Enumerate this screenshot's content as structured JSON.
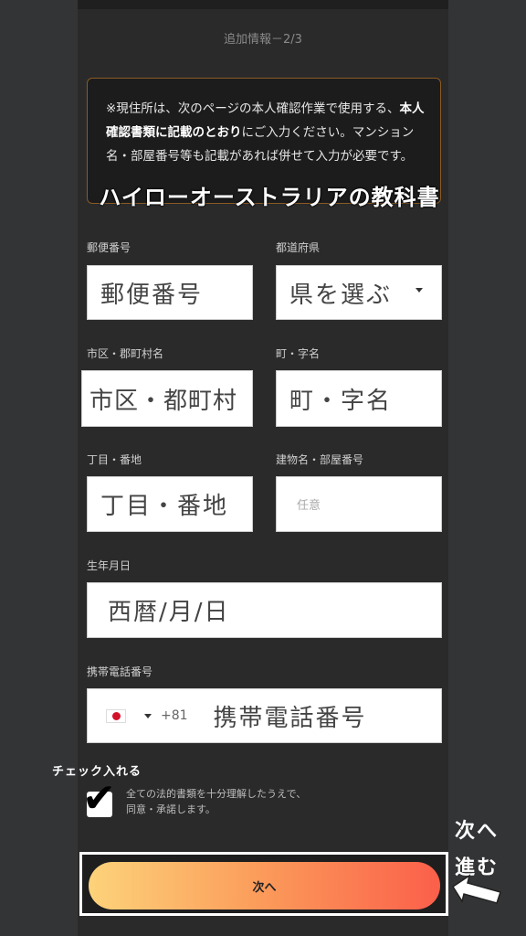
{
  "header": {
    "step": "追加情報－2/3"
  },
  "notice": {
    "part1": "※現住所は、次のページの本人確認作業で使用する、",
    "bold": "本人確認書類に記載のとおり",
    "part2": "にご入力ください。マンション名・部屋番号等も記載があれば併せて入力が必要です。"
  },
  "overlay": {
    "title": "ハイローオーストラリアの教科書"
  },
  "form": {
    "postal": {
      "label": "郵便番号",
      "placeholder": "郵便番号"
    },
    "prefecture": {
      "label": "都道府県",
      "value": "県を選ぶ"
    },
    "city": {
      "label": "市区・郡町村名",
      "placeholder": "市区・都町村"
    },
    "town": {
      "label": "町・字名",
      "placeholder": "町・字名"
    },
    "block": {
      "label": "丁目・番地",
      "placeholder": "丁目・番地"
    },
    "building": {
      "label": "建物名・部屋番号",
      "placeholder": "任意"
    },
    "birth": {
      "label": "生年月日",
      "placeholder": "西暦/月/日"
    },
    "phone": {
      "label": "携帯電話番号",
      "dial_code": "+81",
      "placeholder": "携帯電話番号",
      "flag": "japan-flag-icon"
    }
  },
  "agreement": {
    "annotation": "チェック入れる",
    "line1": "全ての法的書類を十分理解したうえで、",
    "line2": "同意・承諾します。",
    "checked": true
  },
  "next": {
    "label": "次へ"
  },
  "side_note": {
    "line1": "次へ",
    "line2": "進む"
  },
  "colors": {
    "accent_start": "#fdd37a",
    "accent_end": "#fb5f4a",
    "notice_border": "#8a5a24"
  }
}
